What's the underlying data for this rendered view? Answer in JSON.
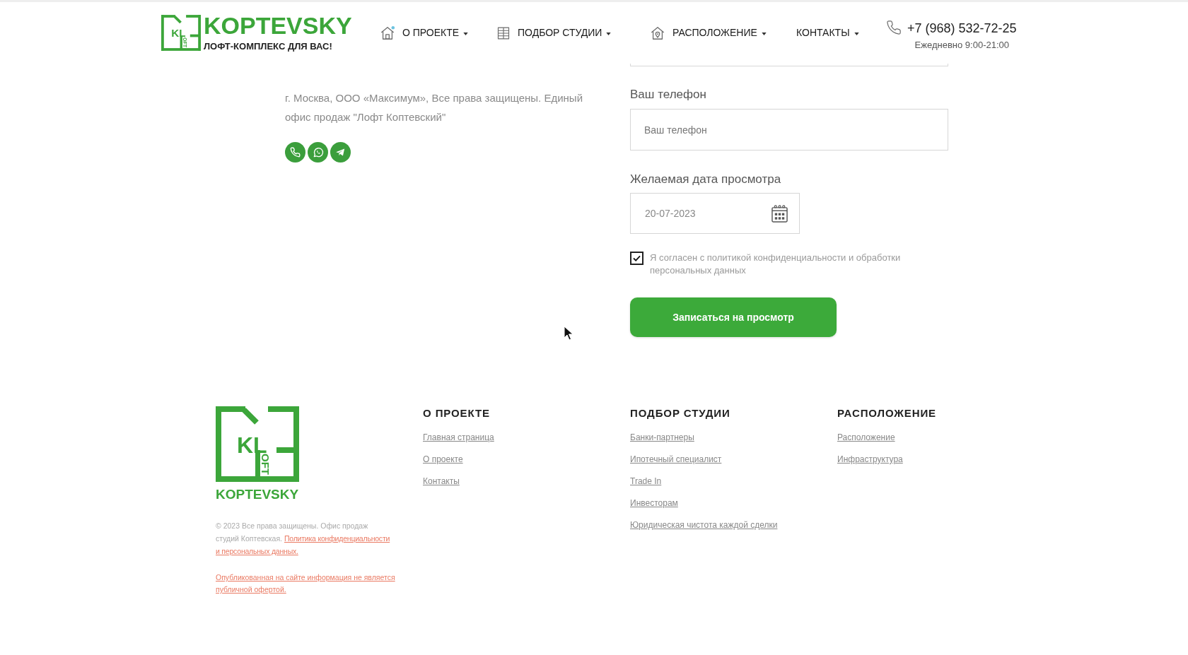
{
  "header": {
    "logo": {
      "mark_letters": "KL",
      "mark_side_letters": "OFT",
      "name": "KOPTEVSKY",
      "tagline": "ЛОФТ-КОМПЛЕКС ДЛЯ ВАС!"
    },
    "nav": [
      {
        "label": "О ПРОЕКТЕ",
        "kind": "project",
        "dropdown": true
      },
      {
        "label": "ПОДБОР СТУДИИ",
        "kind": "studios",
        "dropdown": true
      },
      {
        "label": "РАСПОЛОЖЕНИЕ",
        "kind": "location",
        "dropdown": true
      },
      {
        "label": "КОНТАКТЫ",
        "kind": "contacts",
        "dropdown": true
      }
    ],
    "phone": {
      "number": "+7 (968) 532-72-25",
      "hours": "Ежедневно 9:00-21:00"
    }
  },
  "company_info": {
    "text": "г. Москва, ООО «Максимум», Все права защищены. Единый офис продаж \"Лофт Коптевский\""
  },
  "form": {
    "phone": {
      "label": "Ваш телефон",
      "placeholder": "Ваш телефон"
    },
    "date": {
      "label": "Желаемая дата просмотра",
      "value": "20-07-2023"
    },
    "consent": {
      "checked": true,
      "text": "Я согласен с политикой конфиденциальности и обработки персональных данных"
    },
    "submit": "Записаться на просмотр"
  },
  "footer": {
    "logo": {
      "mark_letters": "KL",
      "mark_side_letters": "OFT",
      "name": "KOPTEVSKY"
    },
    "copyright": "© 2023 Все права защищены. Офис продаж студий Коптевская.",
    "policy_link": [
      "Политика конфиденциальности",
      "и персональных данных."
    ],
    "offer_link": "Опубликованная на сайте информация не является публичной офертой.",
    "columns": [
      {
        "title": "О ПРОЕКТЕ",
        "links": [
          "Главная страница",
          "О проекте",
          "Контакты"
        ]
      },
      {
        "title": "ПОДБОР СТУДИИ",
        "links": [
          "Банки-партнеры",
          "Ипотечный специалист",
          "Trade In",
          "Инвесторам",
          "Юридическая чистота каждой сделки"
        ]
      },
      {
        "title": "РАСПОЛОЖЕНИЕ",
        "links": [
          "Расположение",
          "Инфраструктура"
        ]
      }
    ]
  }
}
